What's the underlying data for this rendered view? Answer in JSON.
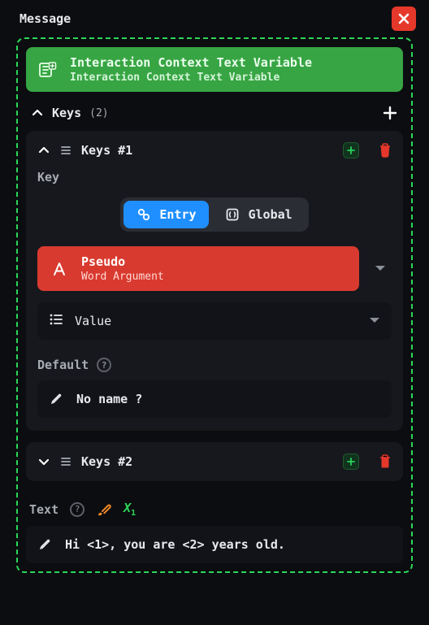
{
  "title": "Message",
  "banner": {
    "title": "Interaction Context Text Variable",
    "subtitle": "Interaction Context Text Variable"
  },
  "keys_section": {
    "label": "Keys",
    "count": "(2)"
  },
  "keys": [
    {
      "title": "Keys #1",
      "expanded": true,
      "key_label": "Key",
      "toggle": {
        "entry": "Entry",
        "global": "Global"
      },
      "selector": {
        "title": "Pseudo",
        "subtitle": "Word Argument"
      },
      "value_label": "Value",
      "default_label": "Default",
      "default_value": "No name ?"
    },
    {
      "title": "Keys #2",
      "expanded": false
    }
  ],
  "text_section": {
    "label": "Text",
    "xvar": "X",
    "value": "Hi <1>, you are <2> years old."
  }
}
